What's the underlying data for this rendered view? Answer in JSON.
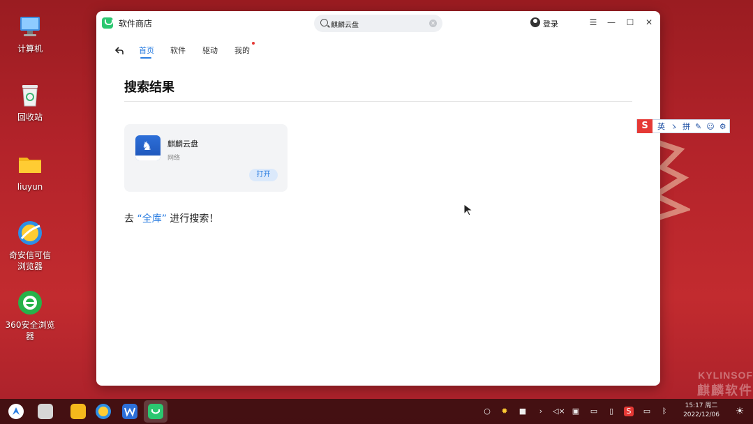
{
  "desktop": {
    "icons": [
      {
        "label": "计算机",
        "icon": "computer-icon"
      },
      {
        "label": "回收站",
        "icon": "trash-icon"
      },
      {
        "label": "liuyun",
        "icon": "folder-icon"
      },
      {
        "label": "奇安信可信浏览器",
        "icon": "qianxin-browser-icon"
      },
      {
        "label": "360安全浏览器",
        "icon": "360-browser-icon"
      }
    ],
    "brand_en": "KYLINSOF",
    "brand_cn": "麒麟软件"
  },
  "window": {
    "title": "软件商店",
    "search": {
      "value": "麒麟云盘",
      "placeholder": ""
    },
    "login_label": "登录",
    "nav": {
      "back_icon": "back-arrow-icon",
      "tabs": [
        "首页",
        "软件",
        "驱动",
        "我的"
      ],
      "active_tab": "首页"
    },
    "heading": "搜索结果",
    "result_card": {
      "name": "麒麟云盘",
      "category": "网络",
      "open_label": "打开"
    },
    "goto_prefix": "去",
    "goto_link": "“全库”",
    "goto_suffix": "进行搜索！"
  },
  "ime": {
    "logo": "S",
    "items": [
      "英",
      "ゝ",
      "拼",
      "✎",
      "☺",
      "⚙"
    ]
  },
  "taskbar": {
    "clock_time": "15:17 周二",
    "clock_date": "2022/12/06"
  },
  "colors": {
    "accent": "#2a7de1",
    "desktop_red": "#b3232a",
    "app_green": "#2bc770"
  }
}
